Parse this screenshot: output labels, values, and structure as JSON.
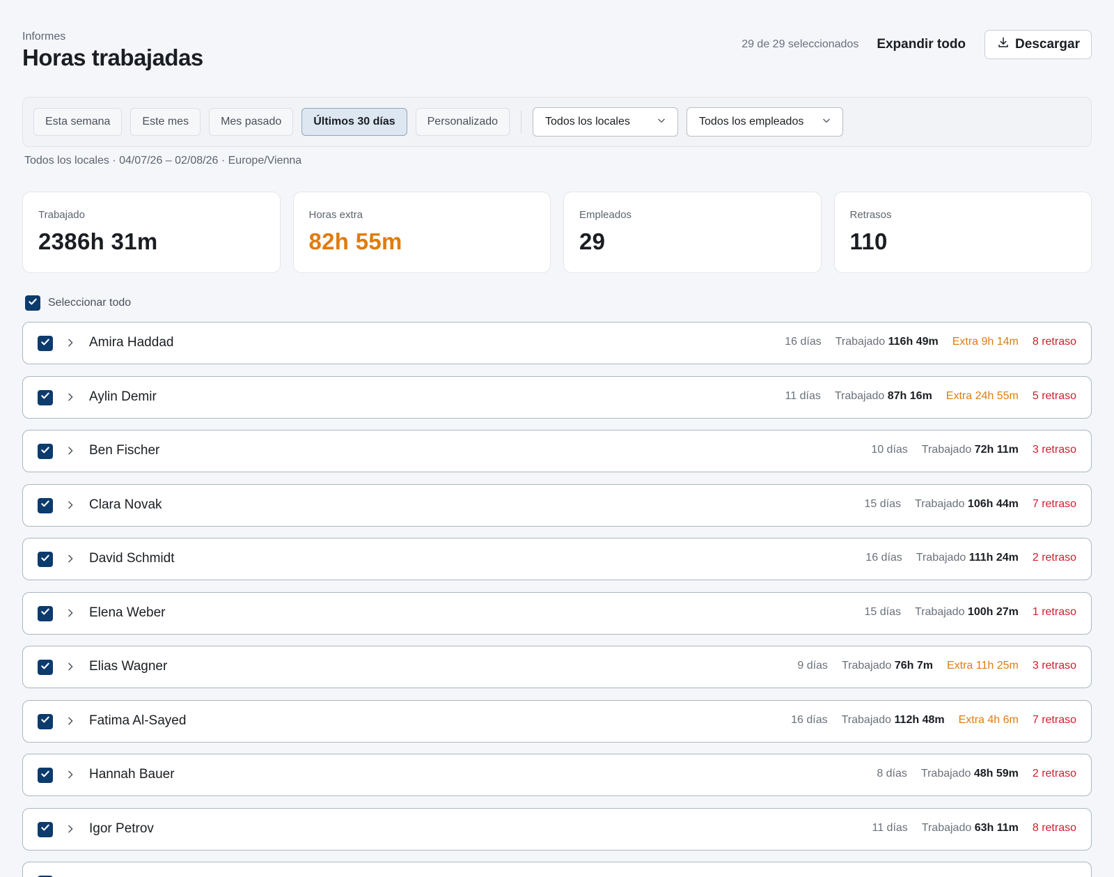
{
  "header": {
    "breadcrumb": "Informes",
    "title": "Horas trabajadas",
    "selected_count": "29 de 29 seleccionados",
    "expand_all": "Expandir todo",
    "download": "Descargar"
  },
  "filters": {
    "ranges": [
      "Esta semana",
      "Este mes",
      "Mes pasado",
      "Últimos 30 días",
      "Personalizado"
    ],
    "active_range": "Últimos 30 días",
    "locations_select": "Todos los locales",
    "employees_select": "Todos los empleados",
    "summary": "Todos los locales · 04/07/26 – 02/08/26 · Europe/Vienna"
  },
  "stats": {
    "worked_label": "Trabajado",
    "worked_value": "2386h 31m",
    "overtime_label": "Horas extra",
    "overtime_value": "82h 55m",
    "employees_label": "Empleados",
    "employees_value": "29",
    "late_label": "Retrasos",
    "late_value": "110"
  },
  "select_all_label": "Seleccionar todo",
  "worked_prefix": "Trabajado",
  "employees": [
    {
      "name": "Amira Haddad",
      "days": "16 días",
      "worked": "116h 49m",
      "extra": "Extra 9h 14m",
      "late": "8 retraso"
    },
    {
      "name": "Aylin Demir",
      "days": "11 días",
      "worked": "87h 16m",
      "extra": "Extra 24h 55m",
      "late": "5 retraso"
    },
    {
      "name": "Ben Fischer",
      "days": "10 días",
      "worked": "72h 11m",
      "extra": "",
      "late": "3 retraso"
    },
    {
      "name": "Clara Novak",
      "days": "15 días",
      "worked": "106h 44m",
      "extra": "",
      "late": "7 retraso"
    },
    {
      "name": "David Schmidt",
      "days": "16 días",
      "worked": "111h 24m",
      "extra": "",
      "late": "2 retraso"
    },
    {
      "name": "Elena Weber",
      "days": "15 días",
      "worked": "100h 27m",
      "extra": "",
      "late": "1 retraso"
    },
    {
      "name": "Elias Wagner",
      "days": "9 días",
      "worked": "76h 7m",
      "extra": "Extra 11h 25m",
      "late": "3 retraso"
    },
    {
      "name": "Fatima Al-Sayed",
      "days": "16 días",
      "worked": "112h 48m",
      "extra": "Extra 4h 6m",
      "late": "7 retraso"
    },
    {
      "name": "Hannah Bauer",
      "days": "8 días",
      "worked": "48h 59m",
      "extra": "",
      "late": "2 retraso"
    },
    {
      "name": "Igor Petrov",
      "days": "11 días",
      "worked": "63h 11m",
      "extra": "",
      "late": "8 retraso"
    }
  ],
  "colors": {
    "accent": "#0c3b6d",
    "overtime": "#e07c0e",
    "late": "#d21c2c"
  },
  "icons": {
    "download": "download-icon",
    "chevron_down": "chevron-down-icon",
    "chevron_right": "chevron-right-icon",
    "check": "check-icon"
  }
}
